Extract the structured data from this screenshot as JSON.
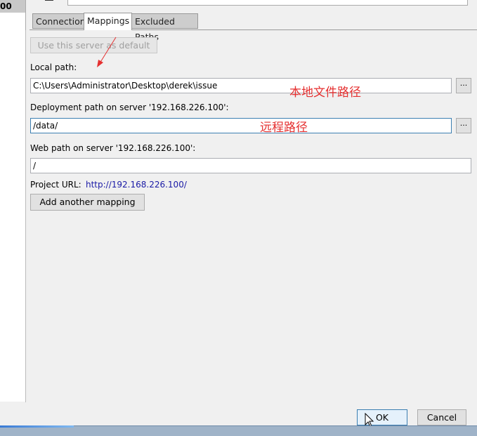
{
  "sidebar": {
    "selected_item": "00"
  },
  "tabs": [
    {
      "label": "Connection"
    },
    {
      "label": "Mappings",
      "active": true
    },
    {
      "label": "Excluded Paths"
    }
  ],
  "mappings": {
    "default_button": "Use this server as default",
    "local_path_label": "Local path:",
    "local_path_value": "C:\\Users\\Administrator\\Desktop\\derek\\issue",
    "deployment_label": "Deployment path on server '192.168.226.100':",
    "deployment_value": "/data/",
    "web_label": "Web path on server '192.168.226.100':",
    "web_value": "/",
    "project_url_label": "Project URL:",
    "project_url": "http://192.168.226.100/",
    "add_mapping_button": "Add another mapping",
    "browse_label": "..."
  },
  "annotations": {
    "local": "本地文件路径",
    "remote": "远程路径",
    "color": "#e53030"
  },
  "footer": {
    "ok": "OK",
    "cancel": "Cancel"
  },
  "colors": {
    "link": "#1a1aa6",
    "ok_border": "#3c7fb1",
    "ok_bg": "#e5f1fb"
  }
}
